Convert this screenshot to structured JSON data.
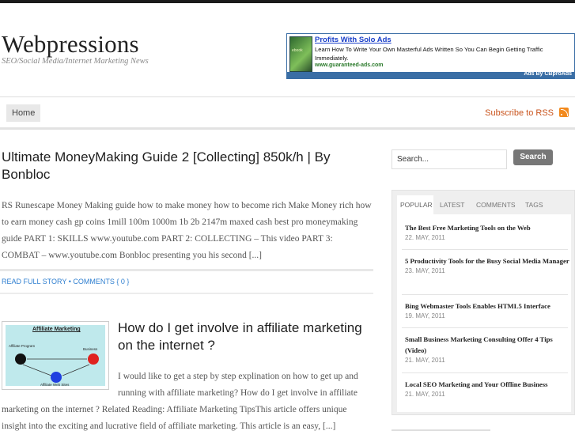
{
  "site": {
    "title": "Webpressions",
    "tagline": "SEO/Social Media/Internet Marketing News"
  },
  "ad": {
    "thumb_label": "ebook",
    "title": "Profits With Solo Ads",
    "text": "Learn How To Write Your Own Masterful Ads Written So You Can Begin Getting Traffic Immediately.",
    "url": "www.guaranteed-ads.com",
    "footer": "Ads By CBproAds",
    "color": "#3a6ea5"
  },
  "nav": {
    "home_label": "Home",
    "subscribe_label": "Subscribe to RSS",
    "rss_icon": "rss-icon"
  },
  "posts": [
    {
      "title": "Ultimate MoneyMaking Guide 2 [Collecting] 850k/h | By Bonbloc",
      "excerpt": "RS Runescape Money Making guide how to make money how to become rich Make Money rich how to earn money cash gp coins 1mill 100m 1000m 1b 2b 2147m maxed cash best pro moneymaking guide PART 1: SKILLS www.youtube.com PART 2: COLLECTING – This video PART 3: COMBAT – www.youtube.com Bonbloc presenting you his second [...]",
      "read_more": "READ FULL STORY",
      "separator": "•",
      "comments": "COMMENTS { 0 }"
    },
    {
      "title": "How do I get involve in affiliate marketing on the internet ?",
      "excerpt_a": "I would like to get a step by step explination on how to get up and running with affiliate marketing? How do I get involve in affiliate",
      "excerpt_b": "marketing on the internet ? Related Reading: Affiliate Marketing TipsThis article offers unique insight into the exciting and lucrative field of affiliate marketing. This article is an easy, [...]",
      "thumb": {
        "title": "Affiliate Marketing",
        "left_label": "Affiliate Program",
        "right_label": "Business",
        "bottom_label": "Affiliate Web Sites"
      }
    }
  ],
  "search": {
    "placeholder": "Search...",
    "button_label": "Search"
  },
  "sidebar_tabs": [
    "POPULAR",
    "LATEST",
    "COMMENTS",
    "TAGS"
  ],
  "popular": [
    {
      "title": "The Best Free Marketing Tools on the Web",
      "date": "22. MAY, 2011"
    },
    {
      "title": "5 Productivity Tools for the Busy Social Media Manager",
      "date": "23. MAY, 2011"
    },
    {
      "title": "Bing Webmaster Tools Enables HTML5 Interface",
      "date": "19. MAY, 2011"
    },
    {
      "title": "Small Business Marketing Consulting Offer 4 Tips (Video)",
      "date": "21. MAY, 2011"
    },
    {
      "title": "Local SEO Marketing and Your Offline Business",
      "date": "21. MAY, 2011"
    }
  ]
}
